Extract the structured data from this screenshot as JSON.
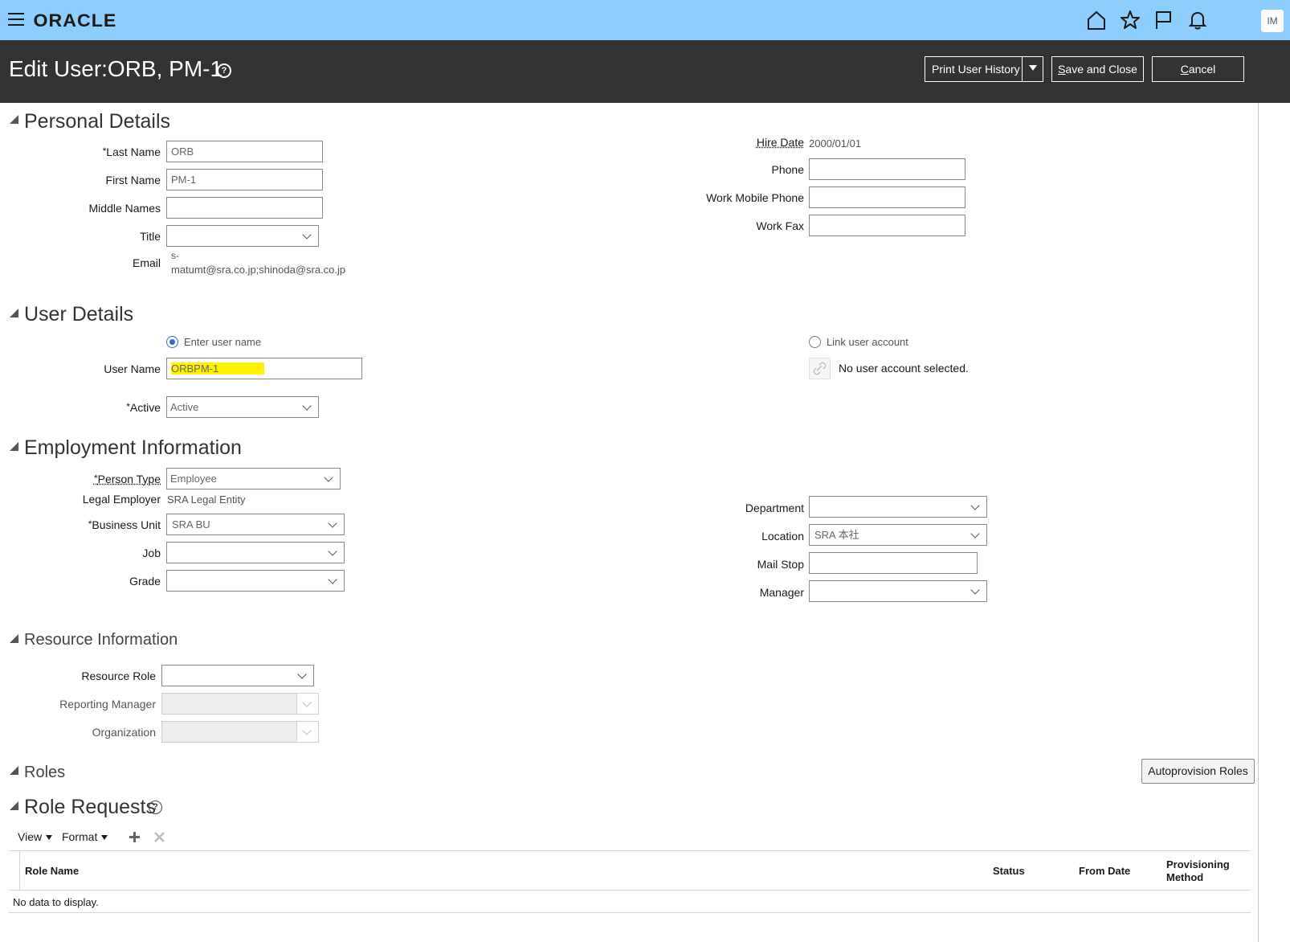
{
  "header": {
    "brand": "ORACLE",
    "avatar_initials": "IM"
  },
  "titlebar": {
    "title": "Edit User:ORB, PM-1",
    "help": "?",
    "print_history": "Print User History",
    "save_close_first": "S",
    "save_close_rest": "ave and Close",
    "cancel_first": "C",
    "cancel_rest": "ancel"
  },
  "personal": {
    "heading": "Personal Details",
    "last_name_label": "Last Name",
    "last_name_value": "ORB",
    "first_name_label": "First Name",
    "first_name_value": "PM-1",
    "middle_names_label": "Middle Names",
    "middle_names_value": "",
    "title_label": "Title",
    "title_value": "",
    "email_label": "Email",
    "email_line1": "s-",
    "email_line2": "matumt@sra.co.jp;shinoda@sra.co.jp",
    "hire_date_label": "Hire Date",
    "hire_date_value": "2000/01/01",
    "phone_label": "Phone",
    "work_mobile_label": "Work Mobile Phone",
    "work_fax_label": "Work Fax",
    "required_mark": "*"
  },
  "user": {
    "heading": "User Details",
    "enter_user_name": "Enter user name",
    "link_user_account": "Link user account",
    "user_name_label": "User Name",
    "user_name_value": "ORBPM-1",
    "no_account": "No user account selected.",
    "active_label": "Active",
    "active_value": "Active"
  },
  "employment": {
    "heading": "Employment Information",
    "person_type_label": "Person Type",
    "person_type_value": "Employee",
    "legal_employer_label": "Legal Employer",
    "legal_employer_value": "SRA Legal Entity",
    "business_unit_label": "Business Unit",
    "business_unit_value": "SRA BU",
    "job_label": "Job",
    "grade_label": "Grade",
    "department_label": "Department",
    "location_label": "Location",
    "location_value": "SRA 本社",
    "mail_stop_label": "Mail Stop",
    "manager_label": "Manager"
  },
  "resource": {
    "heading": "Resource Information",
    "resource_role_label": "Resource Role",
    "reporting_manager_label": "Reporting Manager",
    "organization_label": "Organization"
  },
  "roles": {
    "heading": "Roles",
    "autoprovision": "Autoprovision Roles"
  },
  "role_requests": {
    "heading": "Role Requests",
    "view": "View",
    "format": "Format",
    "columns": [
      "Role Name",
      "Status",
      "From Date",
      "Provisioning",
      "Method"
    ],
    "empty": "No data to display."
  },
  "colors": {
    "topbar": "#8dcefd",
    "titlebar": "#333333",
    "highlight": "#fff200",
    "radio_selected": "#2a6cd6"
  }
}
